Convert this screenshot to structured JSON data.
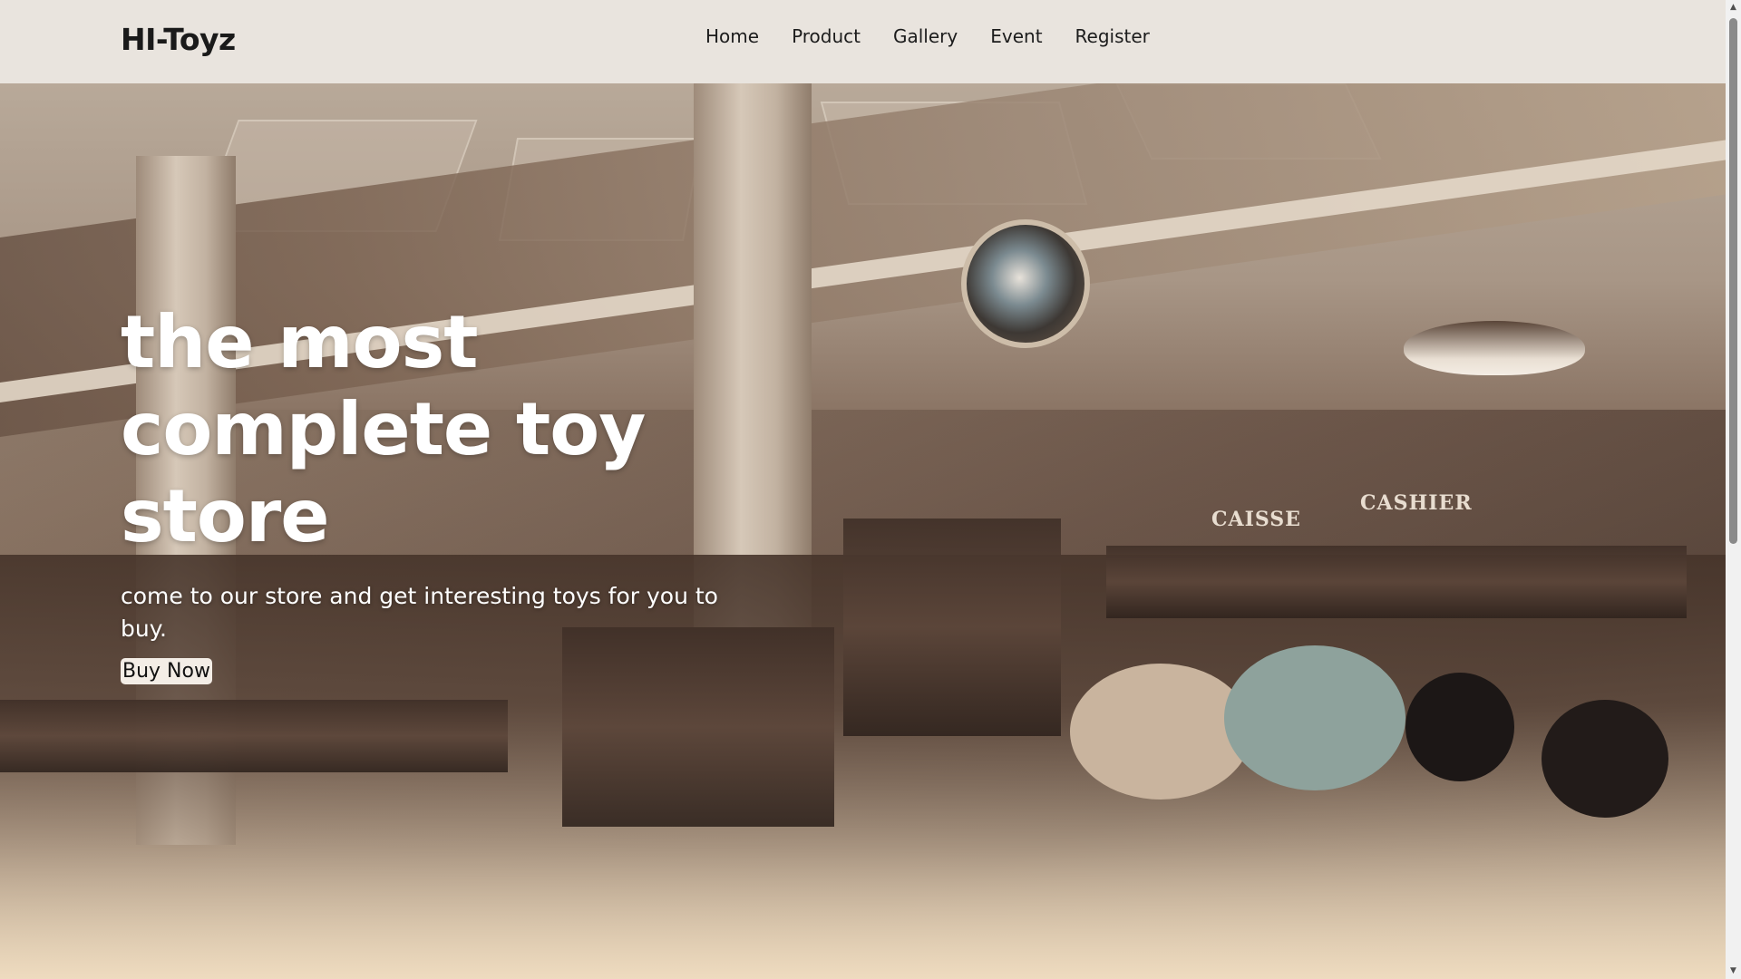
{
  "navbar": {
    "brand": "HI-Toyz",
    "links": [
      {
        "label": "Home"
      },
      {
        "label": "Product"
      },
      {
        "label": "Gallery"
      },
      {
        "label": "Event"
      },
      {
        "label": "Register"
      }
    ]
  },
  "hero": {
    "title": "the most complete toy store",
    "subtitle": "come to our store and get interesting toys for you to buy.",
    "cta_label": "Buy Now",
    "background": "toy-store-interior-photo",
    "signs": [
      "CAISSE",
      "CASHIER"
    ]
  },
  "scrollbar": {
    "up_icon": "chevron-up-icon",
    "down_icon": "chevron-down-icon"
  },
  "colors": {
    "navbar_bg": "#e9e4de",
    "hero_text": "#ffffff",
    "button_bg": "#f3ede6"
  }
}
